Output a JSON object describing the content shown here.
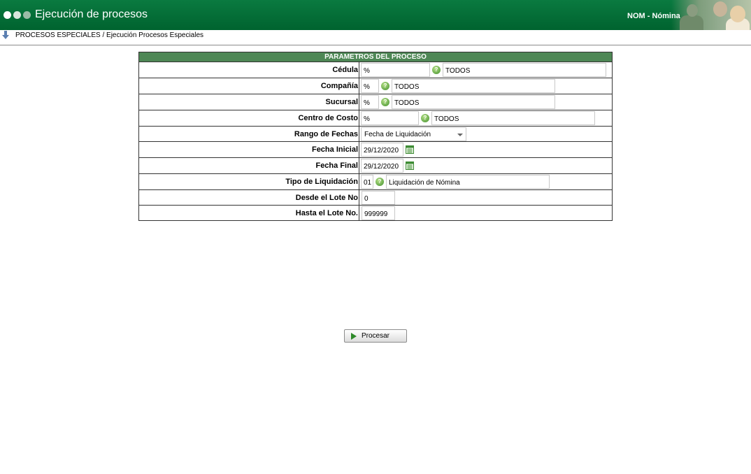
{
  "header": {
    "title": "Ejecución de procesos",
    "module": "NOM - Nómina",
    "colors": {
      "bar": "#006a35",
      "section_header": "#4e8755"
    }
  },
  "breadcrumb": {
    "icon": "down-arrow-icon",
    "text": "PROCESOS ESPECIALES / Ejecución Procesos Especiales"
  },
  "params": {
    "title": "PARAMETROS DEL PROCESO",
    "cedula": {
      "label": "Cédula",
      "code": "%",
      "name": "TODOS"
    },
    "compania": {
      "label": "Compañía",
      "code": "%",
      "name": "TODOS"
    },
    "sucursal": {
      "label": "Sucursal",
      "code": "%",
      "name": "TODOS"
    },
    "centro_costo": {
      "label": "Centro de Costo",
      "code": "%",
      "name": "TODOS"
    },
    "rango_fechas": {
      "label": "Rango de Fechas",
      "selected": "Fecha de Liquidación"
    },
    "fecha_inicial": {
      "label": "Fecha Inicial",
      "value": "29/12/2020"
    },
    "fecha_final": {
      "label": "Fecha Final",
      "value": "29/12/2020"
    },
    "tipo_liquidacion": {
      "label": "Tipo de Liquidación",
      "code": "01",
      "name": "Liquidación de Nómina"
    },
    "desde_lote": {
      "label": "Desde el Lote No",
      "value": "0"
    },
    "hasta_lote": {
      "label": "Hasta el Lote No.",
      "value": "999999"
    }
  },
  "actions": {
    "process_label": "Procesar"
  }
}
